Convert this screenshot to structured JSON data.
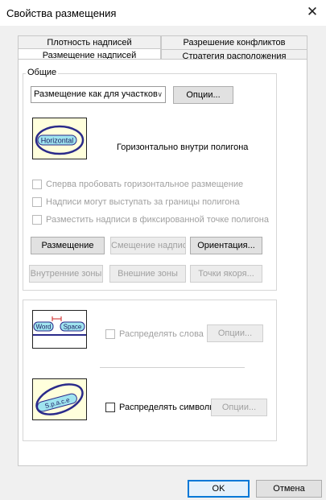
{
  "window": {
    "title": "Свойства размещения",
    "close_glyph": "✕"
  },
  "tabs": {
    "back": [
      "Плотность надписей",
      "Разрешение конфликтов"
    ],
    "front": [
      "Размещение надписей",
      "Стратегия расположения"
    ],
    "active": "Размещение надписей"
  },
  "general": {
    "label": "Общие",
    "placement_select": {
      "value": "Размещение как для участков"
    },
    "options_button": "Опции...",
    "preview_text": "Horizontal",
    "description": "Горизонтально внутри полигона",
    "checkboxes": [
      {
        "label": "Сперва пробовать горизонтальное размещение",
        "checked": false,
        "enabled": false
      },
      {
        "label": "Надписи могут выступать за границы полигона",
        "checked": false,
        "enabled": false
      },
      {
        "label": "Разместить надписи в фиксированной точке полигона",
        "checked": false,
        "enabled": false
      }
    ],
    "buttons_row1": [
      {
        "label": "Размещение",
        "enabled": true
      },
      {
        "label": "Смещение надписи",
        "enabled": false
      },
      {
        "label": "Ориентация...",
        "enabled": true
      }
    ],
    "buttons_row2": [
      {
        "label": "Внутренние зоны",
        "enabled": false
      },
      {
        "label": "Внешние зоны",
        "enabled": false
      },
      {
        "label": "Точки якоря...",
        "enabled": false
      }
    ]
  },
  "spread": {
    "words": {
      "preview_word1": "Word",
      "preview_word2": "Space",
      "label": "Распределять слова",
      "checked": false,
      "enabled": false,
      "options_button": "Опции..."
    },
    "chars": {
      "preview_text": "S.p.a.c.e",
      "label": "Распределять символы",
      "checked": false,
      "enabled": true,
      "options_button": "Опции..."
    }
  },
  "footer": {
    "ok": "OK",
    "cancel": "Отмена"
  },
  "colors": {
    "accent": "#0078d7",
    "preview_fill": "#ffffdc",
    "ellipse_stroke": "#2a2a8a",
    "label_fill": "#9fe4ef"
  }
}
